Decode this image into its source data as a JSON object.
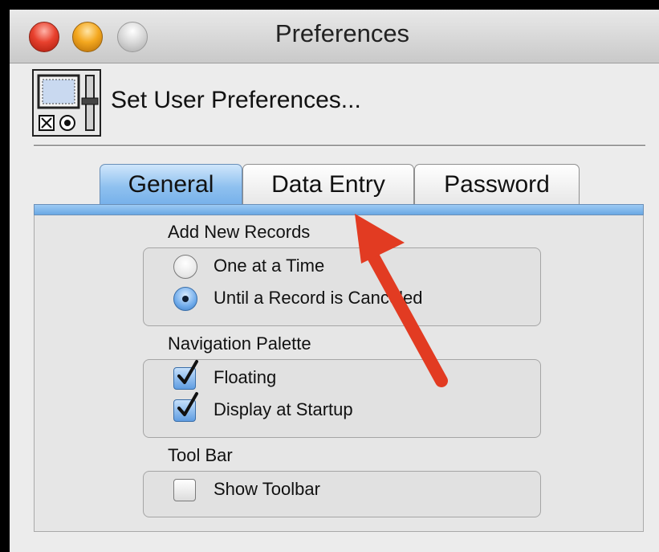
{
  "window": {
    "title": "Preferences"
  },
  "header": {
    "title": "Set User Preferences..."
  },
  "tabs": [
    {
      "label": "General",
      "selected": true
    },
    {
      "label": "Data Entry",
      "selected": false
    },
    {
      "label": "Password",
      "selected": false
    }
  ],
  "sections": {
    "add_new_records": {
      "label": "Add New Records",
      "options": [
        {
          "label": "One at a Time",
          "selected": false
        },
        {
          "label": "Until a Record is Canceled",
          "selected": true
        }
      ]
    },
    "navigation_palette": {
      "label": "Navigation Palette",
      "options": [
        {
          "label": "Floating",
          "checked": true
        },
        {
          "label": "Display at Startup",
          "checked": true
        }
      ]
    },
    "tool_bar": {
      "label": "Tool Bar",
      "options": [
        {
          "label": "Show Toolbar",
          "checked": false
        }
      ]
    }
  },
  "icons": {
    "window_close": "close-button",
    "window_minimize": "minimize-button",
    "window_zoom": "zoom-button",
    "header": "preferences-panel-icon",
    "annotation": "red-arrow-icon"
  },
  "colors": {
    "selected_tab": "#8ec0ef",
    "arrow": "#e23b22",
    "close": "#e8412e",
    "minimize": "#f4a81f"
  }
}
